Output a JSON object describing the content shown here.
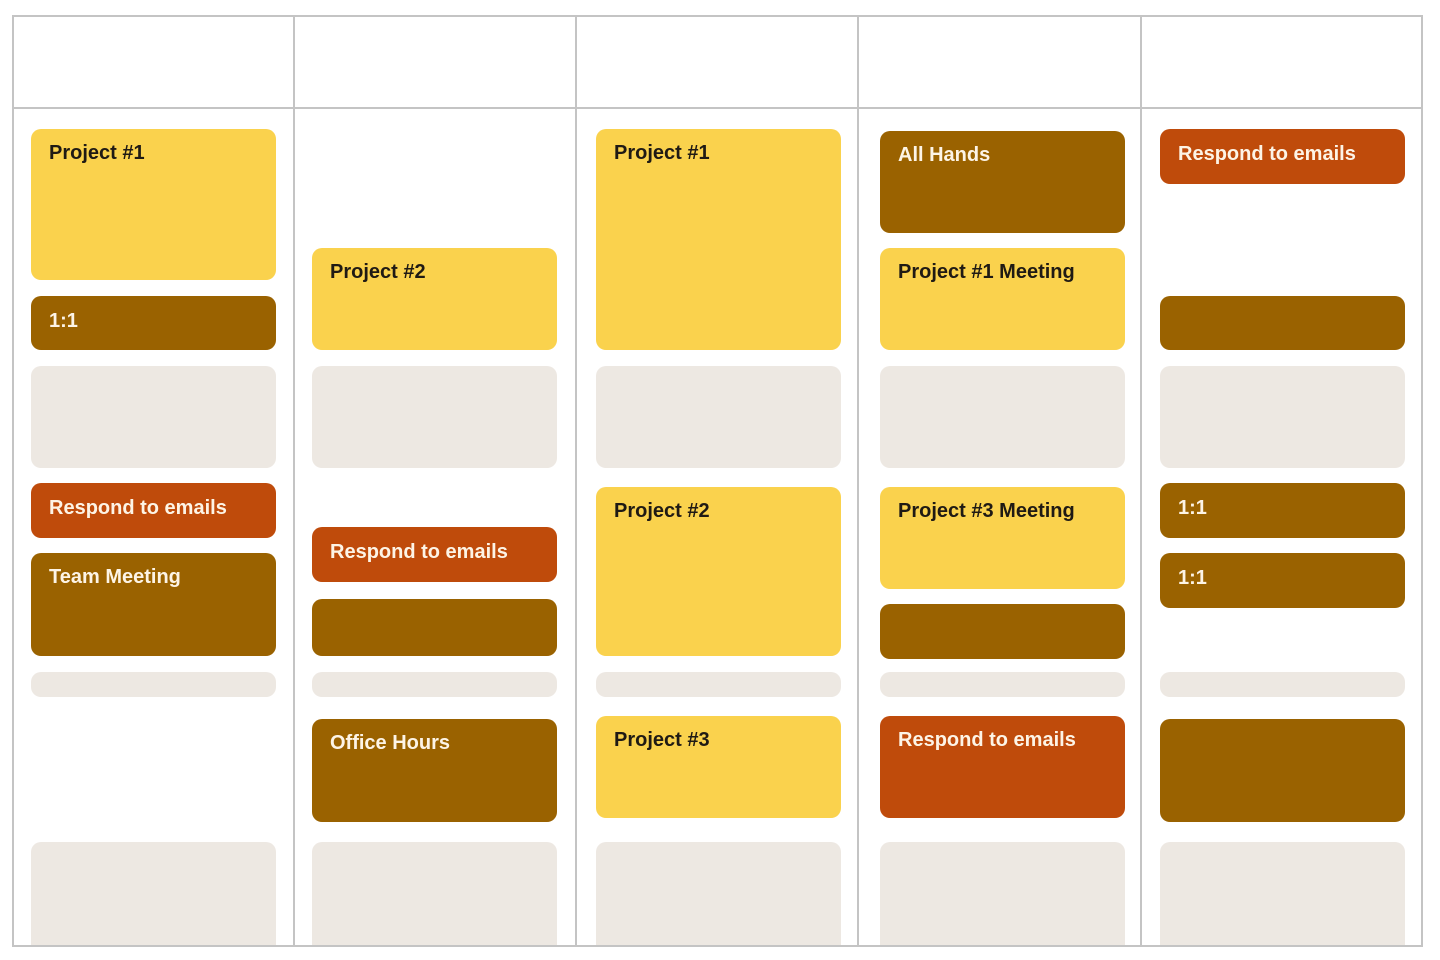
{
  "calendar": {
    "colors": {
      "project": "#fad24d",
      "meeting": "#9a6200",
      "email": "#bf4b0b",
      "placeholder": "#ede8e2",
      "grid_line": "#c4c4c4"
    },
    "header_cells": [
      "",
      "",
      "",
      "",
      ""
    ],
    "columns": [
      {
        "events": [
          {
            "title": "Project #1",
            "type": "project"
          },
          {
            "title": "1:1",
            "type": "meeting"
          },
          {
            "title": "",
            "type": "placeholder"
          },
          {
            "title": "Respond to emails",
            "type": "email"
          },
          {
            "title": "Team Meeting",
            "type": "meeting"
          },
          {
            "title": "",
            "type": "placeholder"
          },
          {
            "title": "",
            "type": "placeholder"
          }
        ]
      },
      {
        "events": [
          {
            "title": "Project #2",
            "type": "project"
          },
          {
            "title": "",
            "type": "placeholder"
          },
          {
            "title": "Respond to emails",
            "type": "email"
          },
          {
            "title": "",
            "type": "meeting"
          },
          {
            "title": "",
            "type": "placeholder"
          },
          {
            "title": "Office Hours",
            "type": "meeting"
          },
          {
            "title": "",
            "type": "placeholder"
          }
        ]
      },
      {
        "events": [
          {
            "title": "Project #1",
            "type": "project"
          },
          {
            "title": "",
            "type": "placeholder"
          },
          {
            "title": "Project #2",
            "type": "project"
          },
          {
            "title": "",
            "type": "placeholder"
          },
          {
            "title": "Project #3",
            "type": "project"
          },
          {
            "title": "",
            "type": "placeholder"
          }
        ]
      },
      {
        "events": [
          {
            "title": "All Hands",
            "type": "meeting"
          },
          {
            "title": "Project #1 Meeting",
            "type": "project"
          },
          {
            "title": "",
            "type": "placeholder"
          },
          {
            "title": "Project #3 Meeting",
            "type": "project"
          },
          {
            "title": "",
            "type": "meeting"
          },
          {
            "title": "",
            "type": "placeholder"
          },
          {
            "title": "Respond to emails",
            "type": "email"
          },
          {
            "title": "",
            "type": "placeholder"
          }
        ]
      },
      {
        "events": [
          {
            "title": "Respond to emails",
            "type": "email"
          },
          {
            "title": "",
            "type": "meeting"
          },
          {
            "title": "",
            "type": "placeholder"
          },
          {
            "title": "1:1",
            "type": "meeting"
          },
          {
            "title": "1:1",
            "type": "meeting"
          },
          {
            "title": "",
            "type": "placeholder"
          },
          {
            "title": "",
            "type": "meeting"
          },
          {
            "title": "",
            "type": "placeholder"
          }
        ]
      }
    ]
  }
}
